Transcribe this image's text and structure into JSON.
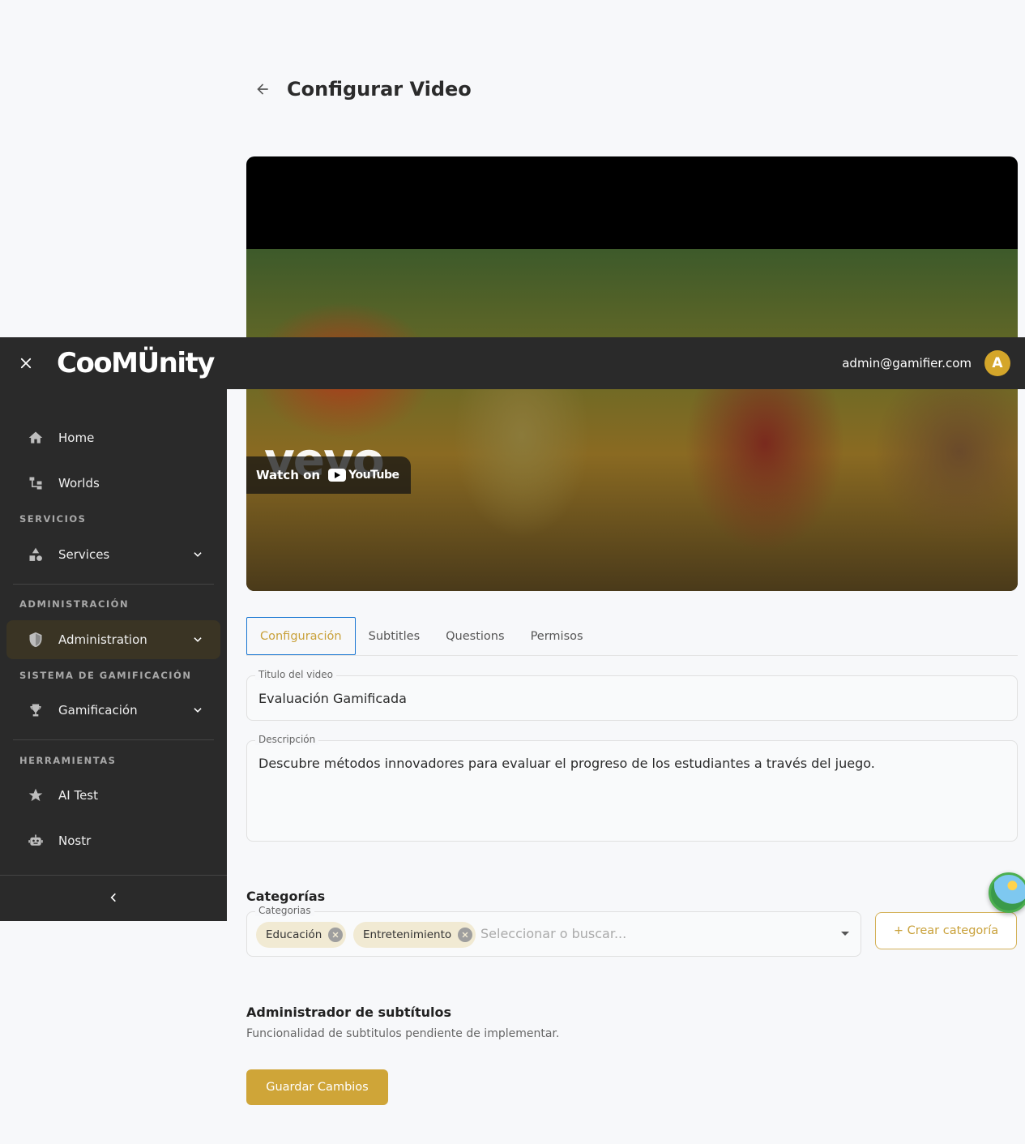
{
  "page": {
    "title": "Configurar Video"
  },
  "video": {
    "overlay_brand": "vevo",
    "watch_on": "Watch on",
    "youtube": "YouTube"
  },
  "appbar": {
    "logo_text": "CooMÜnity",
    "user_email": "admin@gamifier.com",
    "avatar_letter": "A"
  },
  "sidebar": {
    "items": [
      {
        "label": "Home",
        "icon": "home-icon"
      },
      {
        "label": "Worlds",
        "icon": "worlds-icon"
      },
      {
        "label": "Services",
        "icon": "services-icon"
      },
      {
        "label": "Administration",
        "icon": "shield-icon"
      },
      {
        "label": "Gamificación",
        "icon": "trophy-icon"
      },
      {
        "label": "AI Test",
        "icon": "star-icon"
      },
      {
        "label": "Nostr",
        "icon": "robot-icon"
      }
    ],
    "sections": {
      "servicios": "SERVICIOS",
      "administracion": "ADMINISTRACIÓN",
      "gamificacion": "SISTEMA DE GAMIFICACIÓN",
      "herramientas": "HERRAMIENTAS"
    }
  },
  "tabs": [
    "Configuración",
    "Subtitles",
    "Questions",
    "Permisos"
  ],
  "form": {
    "title_label": "Titulo del video",
    "title_value": "Evaluación Gamificada",
    "desc_label": "Descripción",
    "desc_value": "Descubre métodos innovadores para evaluar el progreso de los estudiantes a través del juego."
  },
  "categories": {
    "section_title": "Categorías",
    "field_label": "Categorias",
    "chips": [
      "Educación",
      "Entretenimiento"
    ],
    "placeholder": "Seleccionar o buscar...",
    "create_button": "+ Crear categoría"
  },
  "subtitles": {
    "section_title": "Administrador de subtítulos",
    "note": "Funcionalidad de subtitulos pendiente de implementar."
  },
  "actions": {
    "save": "Guardar Cambios"
  },
  "colors": {
    "accent": "#cfa538",
    "sidebar_bg": "#2a2a2a",
    "tab_focus": "#1976d2"
  }
}
